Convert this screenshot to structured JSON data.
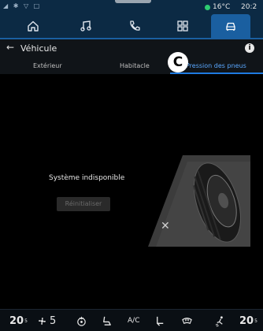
{
  "status_bar": {
    "left_icons": "◢ ✱ ▽ □",
    "temperature": "16°C",
    "time": "20:2"
  },
  "nav": {
    "items": [
      {
        "name": "home",
        "icon": "home-icon"
      },
      {
        "name": "music",
        "icon": "music-icon"
      },
      {
        "name": "phone",
        "icon": "phone-icon"
      },
      {
        "name": "apps",
        "icon": "apps-icon"
      },
      {
        "name": "vehicle",
        "icon": "car-icon",
        "active": true
      }
    ]
  },
  "header": {
    "back_symbol": "←",
    "title": "Véhicule",
    "info_symbol": "i"
  },
  "tabs": [
    {
      "label": "Extérieur"
    },
    {
      "label": "Habitacle"
    },
    {
      "label": "Pression des pneus",
      "active": true
    }
  ],
  "callout_label": "C",
  "content": {
    "message": "Système indisponible",
    "reset_label": "Réinitialiser",
    "dismiss_symbol": "✕"
  },
  "climate": {
    "left_temp": "20",
    "left_temp_unit": "5",
    "fan_level": "5",
    "ac_label": "A/C",
    "right_temp": "20",
    "right_temp_unit": "5"
  },
  "colors": {
    "nav_bg": "#0c2a44",
    "active_blue": "#1a5fa0",
    "tab_accent": "#5aa8ff",
    "temp_indicator": "#2ecc71"
  }
}
